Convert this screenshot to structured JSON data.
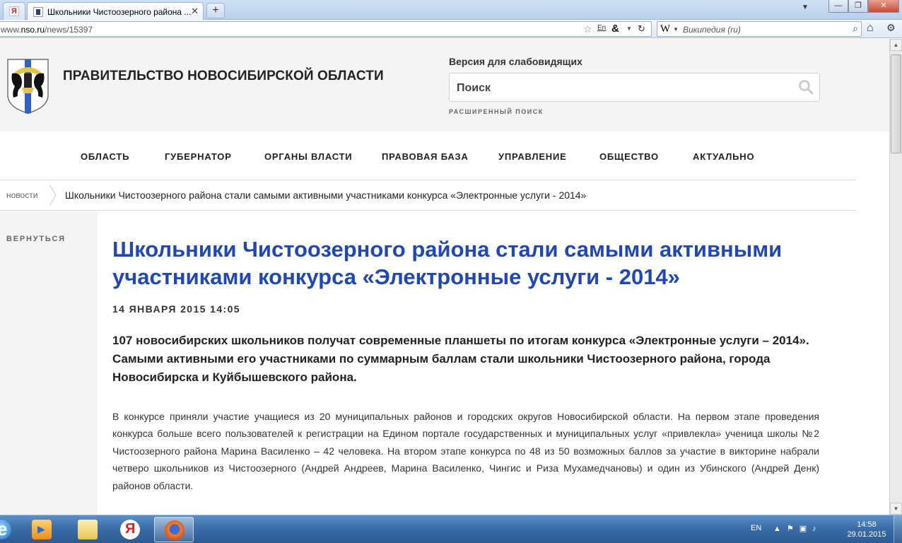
{
  "browser": {
    "tabs": [
      {
        "label": "Я",
        "type": "yandex"
      },
      {
        "label": "Школьники Чистоозерного района ...",
        "active": true
      }
    ],
    "new_tab_label": "+",
    "url_prefix": "www.",
    "url_domain": "nso.ru",
    "url_path": "/news/15397",
    "translate_label": "En",
    "amp_label": "&",
    "search_engine_icon": "W",
    "search_engine_label": "Википедия (ru)"
  },
  "site": {
    "title": "ПРАВИТЕЛЬСТВО НОВОСИБИРСКОЙ ОБЛАСТИ",
    "vision_link": "Версия для слабовидящих",
    "search_placeholder": "Поиск",
    "advanced_search": "РАСШИРЕННЫЙ ПОИСК",
    "nav": [
      {
        "label": "ОБЛАСТЬ"
      },
      {
        "label": "ГУБЕРНАТОР"
      },
      {
        "label": "ОРГАНЫ ВЛАСТИ"
      },
      {
        "label": "ПРАВОВАЯ БАЗА"
      },
      {
        "label": "УПРАВЛЕНИЕ"
      },
      {
        "label": "ОБЩЕСТВО"
      },
      {
        "label": "АКТУАЛЬНО"
      }
    ],
    "breadcrumb": {
      "home": "новости",
      "current": "Школьники Чистоозерного района стали самыми активными участниками конкурса «Электронные услуги - 2014»"
    },
    "back_link": "ВЕРНУТЬСЯ"
  },
  "article": {
    "headline": "Школьники Чистоозерного района стали самыми активными участниками конкурса «Электронные услуги - 2014»",
    "date": "14 ЯНВАРЯ 2015 14:05",
    "lead": "107 новосибирских школьников получат современные планшеты по итогам конкурса «Электронные услуги – 2014». Самыми активными его участниками по суммарным баллам стали школьники Чистоозерного района, города Новосибирска и Куйбышевского района.",
    "body": "В конкурсе приняли участие учащиеся из 20 муниципальных районов и городских округов Новосибирской области. На первом этапе проведения конкурса больше всего пользователей к регистрации на Едином портале государственных и муниципальных услуг «привлекла» ученица школы №2 Чистоозерного района Марина Василенко – 42 человека. На втором этапе конкурса по 48 из 50 возможных баллов за участие в викторине набрали четверо школьников из Чистоозерного (Андрей Андреев, Марина Василенко, Чингис и Риза Мухамедчановы) и один из Убинского (Андрей Денк) районов области."
  },
  "taskbar": {
    "apps": [
      {
        "name": "internet-explorer-icon"
      },
      {
        "name": "media-player-icon"
      },
      {
        "name": "explorer-folder-icon"
      },
      {
        "name": "yandex-browser-icon"
      },
      {
        "name": "firefox-icon",
        "active": true
      }
    ],
    "language": "EN",
    "time": "14:58",
    "date": "29.01.2015"
  },
  "colors": {
    "headline": "#1f47b8",
    "header_bg": "#f4f4f4",
    "taskbar": "#3b6ea8"
  }
}
